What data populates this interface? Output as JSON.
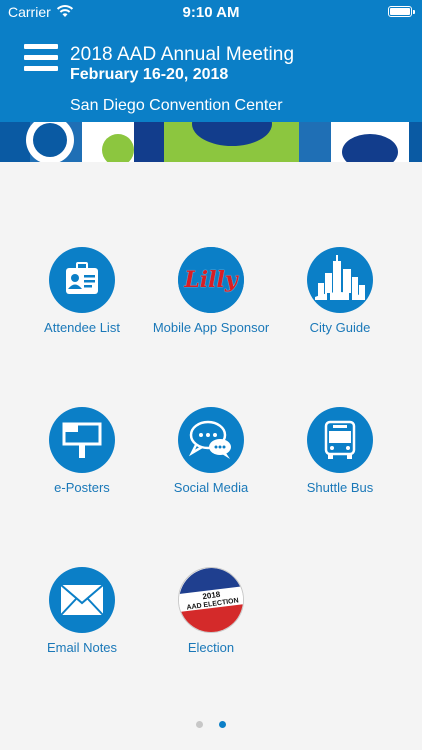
{
  "status": {
    "carrier": "Carrier",
    "time": "9:10 AM"
  },
  "header": {
    "title": "2018 AAD Annual Meeting",
    "dates": "February 16-20, 2018",
    "venue": "San Diego Convention Center"
  },
  "sponsor_logo_text": "Lilly",
  "election_badge": {
    "line1": "2018",
    "line2": "AAD ELECTION"
  },
  "tiles": [
    {
      "label": "Attendee List",
      "icon": "id-badge-icon"
    },
    {
      "label": "Mobile App Sponsor",
      "icon": "lilly-logo-icon"
    },
    {
      "label": "City Guide",
      "icon": "city-skyline-icon"
    },
    {
      "label": "e-Posters",
      "icon": "poster-board-icon"
    },
    {
      "label": "Social Media",
      "icon": "chat-bubbles-icon"
    },
    {
      "label": "Shuttle Bus",
      "icon": "bus-icon"
    },
    {
      "label": "Email Notes",
      "icon": "envelope-icon"
    },
    {
      "label": "Election",
      "icon": "election-badge-icon"
    }
  ],
  "pagination": {
    "pages": 2,
    "current": 2
  },
  "colors": {
    "brand": "#0b7fc7",
    "label": "#1a78b8",
    "background": "#f4f4f4",
    "dot_active": "#0b7fc7",
    "dot_inactive": "#c7c7c7"
  }
}
